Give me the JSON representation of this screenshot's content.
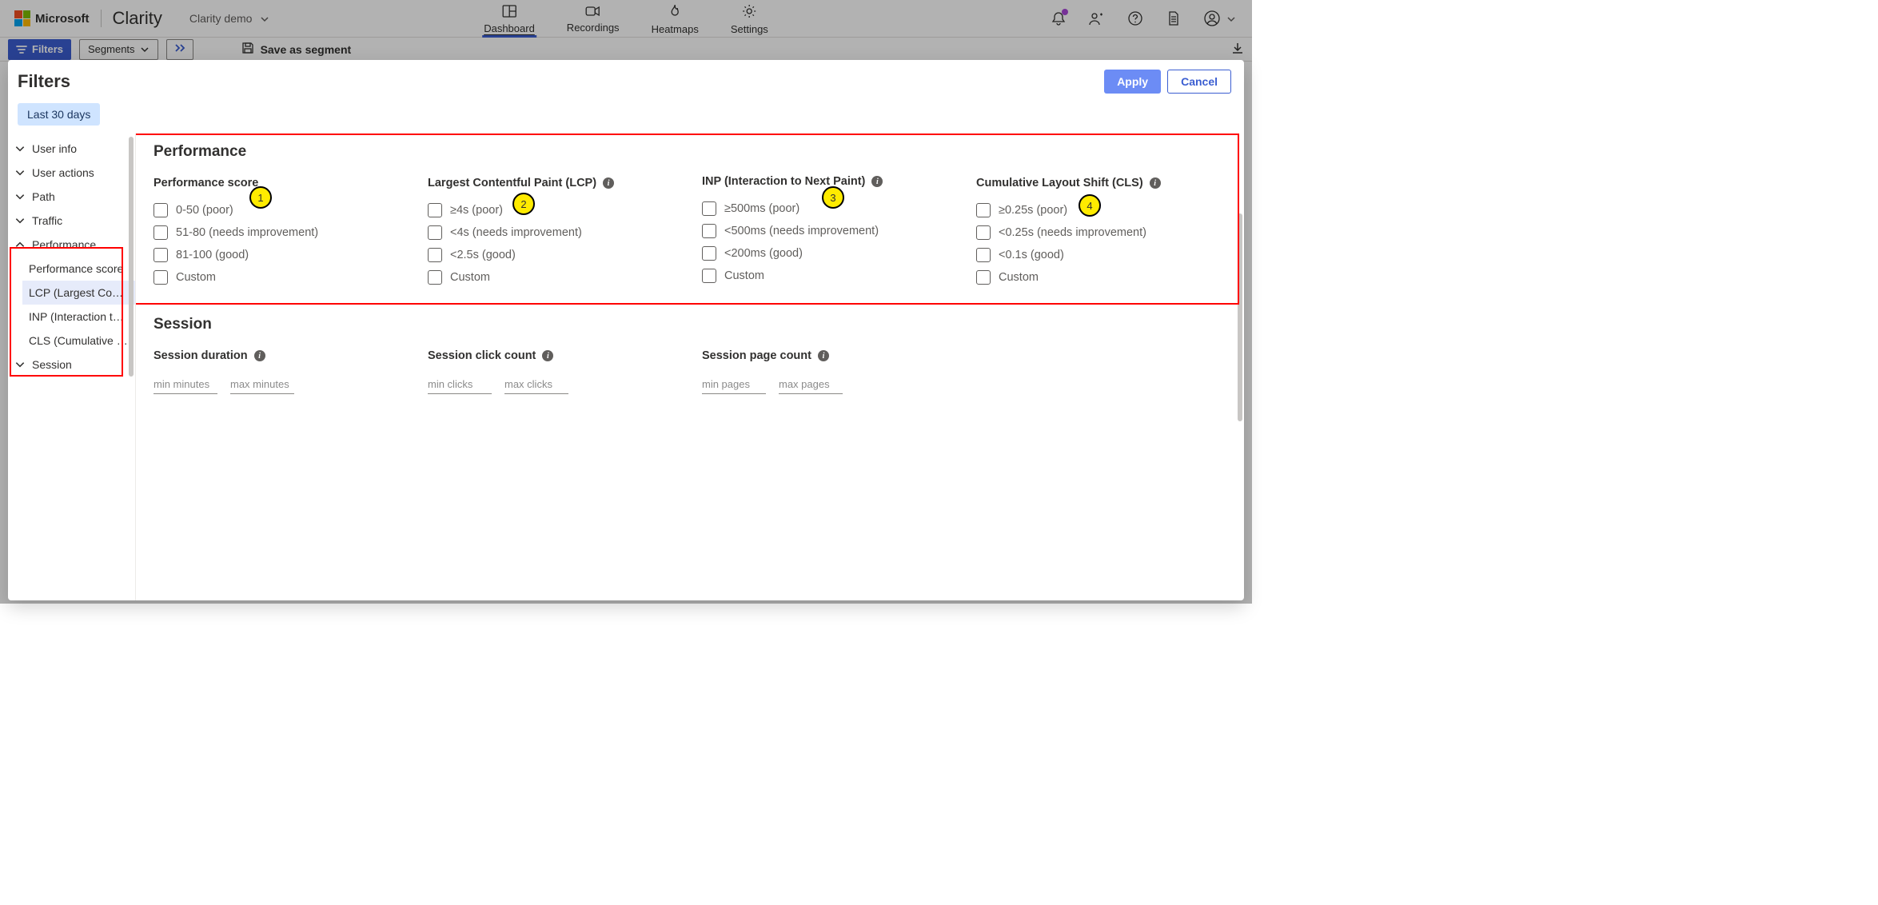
{
  "header": {
    "ms": "Microsoft",
    "product": "Clarity",
    "project": "Clarity demo",
    "nav": {
      "dashboard": "Dashboard",
      "recordings": "Recordings",
      "heatmaps": "Heatmaps",
      "settings": "Settings"
    }
  },
  "actions": {
    "filters": "Filters",
    "segments": "Segments",
    "save_segment": "Save as segment"
  },
  "modal": {
    "title": "Filters",
    "apply": "Apply",
    "cancel": "Cancel",
    "date_pill": "Last 30 days",
    "tree": {
      "user_info": "User info",
      "user_actions": "User actions",
      "path": "Path",
      "traffic": "Traffic",
      "performance": "Performance",
      "perf_children": {
        "score": "Performance score",
        "lcp": "LCP (Largest Contentfu…",
        "inp": "INP (Interaction to Nex…",
        "cls": "CLS (Cumulative Layou…"
      },
      "session": "Session"
    },
    "content": {
      "performance_title": "Performance",
      "col_score": {
        "title": "Performance score",
        "opts": [
          "0-50 (poor)",
          "51-80 (needs improvement)",
          "81-100 (good)",
          "Custom"
        ]
      },
      "col_lcp": {
        "title": "Largest Contentful Paint (LCP)",
        "opts": [
          "≥4s (poor)",
          "<4s (needs improvement)",
          "<2.5s (good)",
          "Custom"
        ]
      },
      "col_inp": {
        "title": "INP (Interaction to Next Paint)",
        "opts": [
          "≥500ms (poor)",
          "<500ms (needs improvement)",
          "<200ms (good)",
          "Custom"
        ]
      },
      "col_cls": {
        "title": "Cumulative Layout Shift (CLS)",
        "opts": [
          "≥0.25s (poor)",
          "<0.25s (needs improvement)",
          "<0.1s (good)",
          "Custom"
        ]
      },
      "callouts": [
        "1",
        "2",
        "3",
        "4"
      ],
      "session_title": "Session",
      "session_cols": {
        "duration": {
          "title": "Session duration",
          "min_ph": "min minutes",
          "max_ph": "max minutes"
        },
        "clicks": {
          "title": "Session click count",
          "min_ph": "min clicks",
          "max_ph": "max clicks"
        },
        "pages": {
          "title": "Session page count",
          "min_ph": "min pages",
          "max_ph": "max pages"
        }
      }
    }
  }
}
